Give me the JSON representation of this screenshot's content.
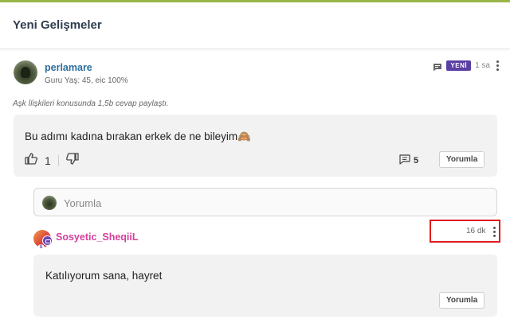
{
  "panel": {
    "title": "Yeni Gelişmeler"
  },
  "post": {
    "author": "perlamare",
    "author_meta": "Guru Yaş: 45, eic 100%",
    "badge": "YENİ",
    "time": "1 sa",
    "activity": "Aşk İlişkileri konusunda 1,5b cevap paylaştı.",
    "text": "Bu adımı kadına bırakan erkek de ne bileyim🙈",
    "like_count": "1",
    "comment_count": "5",
    "comment_button": "Yorumla"
  },
  "comment_input": {
    "placeholder": "Yorumla"
  },
  "reply": {
    "author": "Sosyetic_SheqiiL",
    "avatar_badge_letter": "S",
    "time": "16 dk",
    "text": "Katılıyorum sana, hayret",
    "comment_button": "Yorumla"
  },
  "colors": {
    "accent_top": "#9ab54a",
    "username": "#2c6e9b",
    "badge_new": "#5b3fa3",
    "reply_username": "#d6409f",
    "highlight": "#e01b1b"
  }
}
